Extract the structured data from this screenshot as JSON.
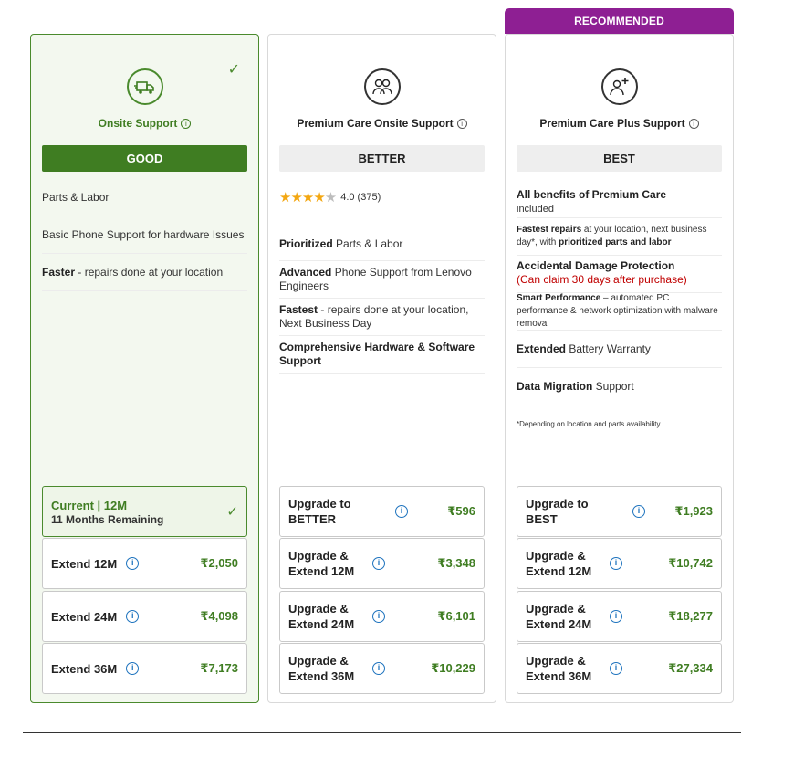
{
  "recommended_badge": "RECOMMENDED",
  "plans": [
    {
      "title": "Onsite Support",
      "tier": "GOOD",
      "features": [
        {
          "bold": "",
          "text": "Parts & Labor"
        },
        {
          "bold": "",
          "text": "Basic Phone Support for hardware Issues"
        },
        {
          "bold": "Faster",
          "text": " - repairs done at your location"
        }
      ],
      "current": {
        "label": "Current | 12M",
        "sub": "11 Months Remaining"
      },
      "options": [
        {
          "label": "Extend 12M",
          "price": "₹2,050"
        },
        {
          "label": "Extend 24M",
          "price": "₹4,098"
        },
        {
          "label": "Extend 36M",
          "price": "₹7,173"
        }
      ]
    },
    {
      "title": "Premium Care Onsite Support",
      "tier": "BETTER",
      "rating": {
        "value": "4.0",
        "count": "(375)",
        "stars": 4
      },
      "features": [
        {
          "bold": "Prioritized",
          "text": " Parts & Labor"
        },
        {
          "bold": "Advanced",
          "text": " Phone Support from Lenovo Engineers"
        },
        {
          "bold": "Fastest",
          "text": " - repairs done at your location, Next Business Day"
        },
        {
          "bold": "Comprehensive Hardware & Software Support",
          "text": ""
        }
      ],
      "options": [
        {
          "label": "Upgrade to BETTER",
          "price": "₹596"
        },
        {
          "label": "Upgrade & Extend 12M",
          "price": "₹3,348"
        },
        {
          "label": "Upgrade & Extend 24M",
          "price": "₹6,101"
        },
        {
          "label": "Upgrade & Extend 36M",
          "price": "₹10,229"
        }
      ]
    },
    {
      "title": "Premium Care Plus Support",
      "tier": "BEST",
      "features": [
        {
          "bold": "All benefits of Premium Care",
          "text": "included"
        },
        {
          "bold1": "Fastest repairs",
          "text1": " at your location, next business day*, with ",
          "bold2": "prioritized parts and labor"
        },
        {
          "bold": "Accidental Damage Protection",
          "red": "(Can claim 30 days after purchase)"
        },
        {
          "bold": "Smart Performance",
          "text": " – automated PC performance & network optimization with malware removal"
        },
        {
          "bold": "Extended",
          "text": " Battery Warranty"
        },
        {
          "bold": "Data Migration",
          "text": " Support"
        },
        {
          "note": "*Depending on location and parts availability"
        }
      ],
      "options": [
        {
          "label": "Upgrade to BEST",
          "price": "₹1,923"
        },
        {
          "label": "Upgrade & Extend 12M",
          "price": "₹10,742"
        },
        {
          "label": "Upgrade & Extend 24M",
          "price": "₹18,277"
        },
        {
          "label": "Upgrade & Extend 36M",
          "price": "₹27,334"
        }
      ]
    }
  ],
  "colors": {
    "good_green": "#3f7d22",
    "recommended_purple": "#8e1f93",
    "info_blue": "#1e73be"
  }
}
